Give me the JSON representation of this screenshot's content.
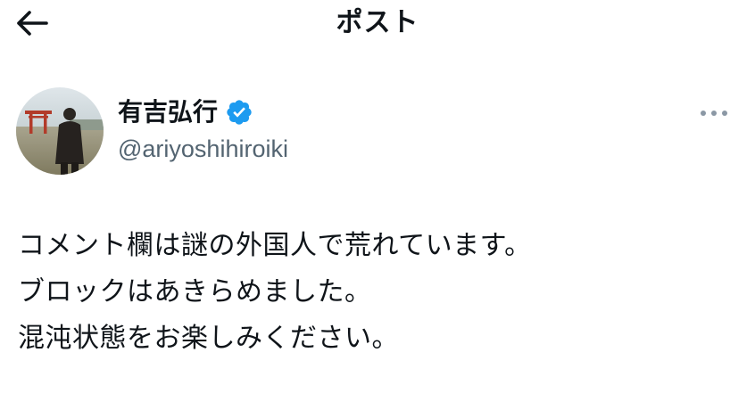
{
  "header": {
    "title": "ポスト",
    "back_icon": "arrow-left-icon"
  },
  "author": {
    "display_name": "有吉弘行",
    "handle": "@ariyoshihiroiki",
    "verified": true,
    "verified_color": "#1d9bf0",
    "avatar_icon": "profile-photo"
  },
  "post": {
    "lines": [
      "コメント欄は謎の外国人で荒れています。",
      "ブロックはあきらめました。",
      "混沌状態をお楽しみください。"
    ]
  },
  "colors": {
    "text": "#0f1419",
    "secondary": "#536471",
    "accent": "#1d9bf0"
  }
}
